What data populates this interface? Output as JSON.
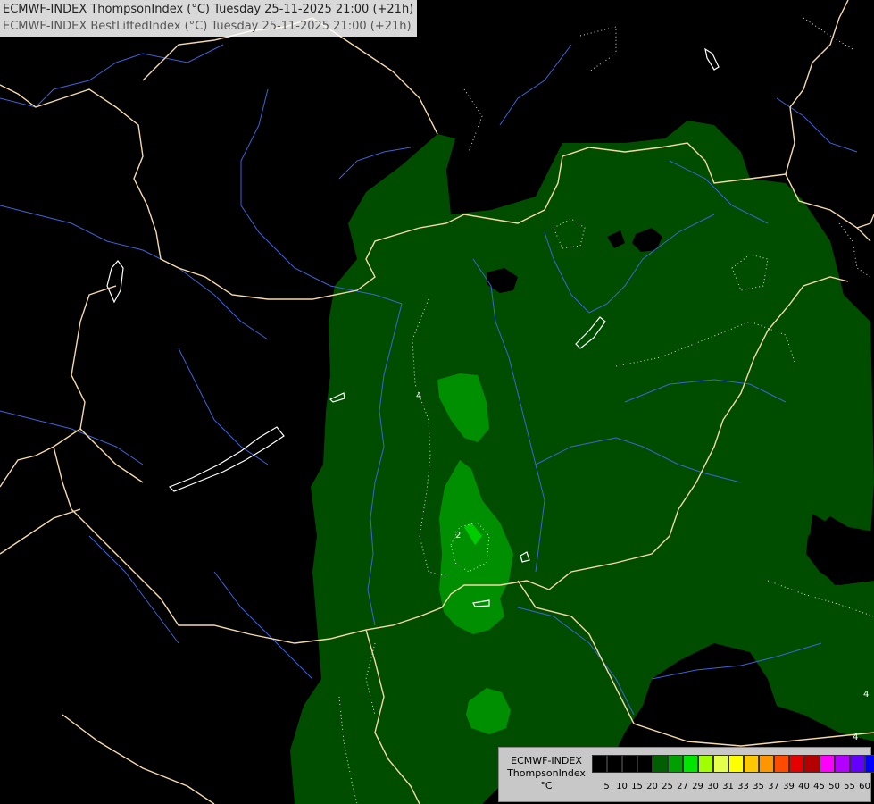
{
  "header": {
    "line1": "ECMWF-INDEX ThompsonIndex (°C) Tuesday 25-11-2025 21:00 (+21h)",
    "line2": "ECMWF-INDEX BestLiftedIndex (°C) Tuesday 25-11-2025 21:00 (+21h)"
  },
  "legend": {
    "line1": "ECMWF-INDEX",
    "line2": "ThompsonIndex",
    "unit": "°C",
    "ticks": [
      "5",
      "10",
      "15",
      "20",
      "25",
      "27",
      "29",
      "30",
      "31",
      "33",
      "35",
      "37",
      "39",
      "40",
      "45",
      "50",
      "55",
      "60"
    ],
    "colors": [
      "#000000",
      "#000000",
      "#000000",
      "#000000",
      "#005f00",
      "#00a000",
      "#00e600",
      "#a0ff00",
      "#e6ff4b",
      "#ffff00",
      "#ffc800",
      "#ff9600",
      "#ff4b00",
      "#e60000",
      "#b40000",
      "#ff00ff",
      "#b400ff",
      "#6400ff",
      "#0000ff"
    ]
  },
  "contour_labels": [
    "4",
    "2",
    "4",
    "4"
  ],
  "colors": {
    "background": "#000000",
    "fill_low": "#004d00",
    "fill_mid": "#008f00",
    "fill_high": "#00cc00",
    "border": "#f5d9a8",
    "river": "#3d62d8",
    "lake": "#ffffff"
  }
}
